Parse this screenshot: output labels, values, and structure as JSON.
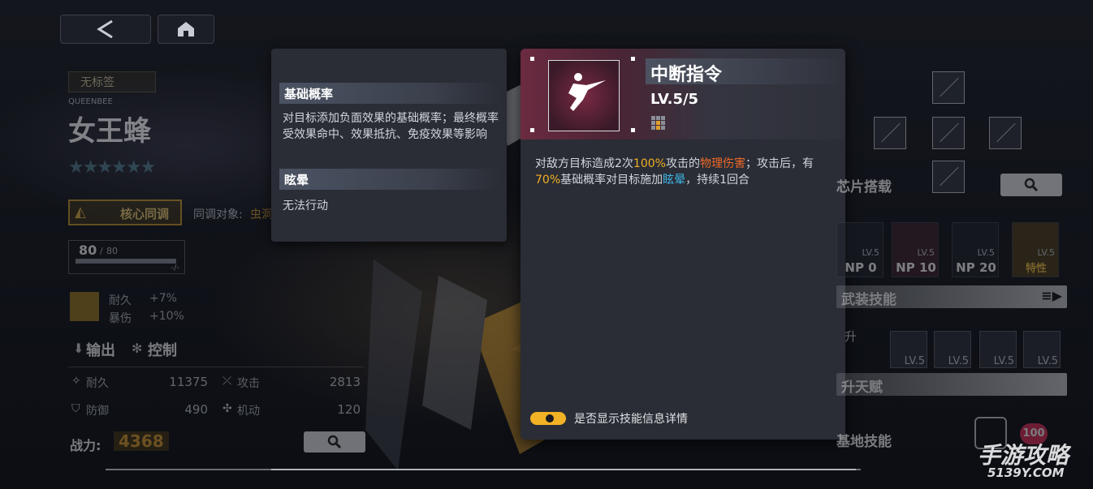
{
  "nav": {
    "back_icon": "back-chevron-icon",
    "home_icon": "home-icon"
  },
  "character": {
    "tag": "无标签",
    "code_name": "QUEENBEE",
    "name": "女王蜂",
    "stars": "★★★★★★",
    "sync_label": "核心同调",
    "sync_target_label": "同调对象:",
    "sync_target_value": "虫洞",
    "level_current": "80",
    "level_max": "80",
    "exp_text": "-/-",
    "bonus1_label": "耐久",
    "bonus1_value": "+7%",
    "bonus2_label": "暴伤",
    "bonus2_value": "+10%",
    "role1": "输出",
    "role2": "控制",
    "stats": [
      {
        "label": "耐久",
        "value": "11375"
      },
      {
        "label": "攻击",
        "value": "2813"
      },
      {
        "label": "防御",
        "value": "490"
      },
      {
        "label": "机动",
        "value": "120"
      }
    ],
    "power_label": "战力:",
    "power_value": "4368"
  },
  "tooltip": {
    "section1_title": "基础概率",
    "section1_text": "对目标添加负面效果的基础概率；最终概率受效果命中、效果抵抗、免疫效果等影响",
    "section2_title": "眩晕",
    "section2_text": "无法行动"
  },
  "skill": {
    "name": "中断指令",
    "level": "LV.5/5",
    "desc": {
      "p1": "对敌方目标造成2次",
      "v1": "100%",
      "p2": "攻击的",
      "v2": "物理伤害",
      "p3": "；攻击后，有",
      "v3": "70%",
      "p4": "基础概率对目标施加",
      "v4": "眩晕",
      "p5": "，持续1回合"
    },
    "toggle_label": "是否显示技能信息详情",
    "toggle_on": true
  },
  "right": {
    "chip_title": "芯片搭载",
    "equip_title": "武装技能",
    "skills": [
      {
        "np": "NP 0",
        "lv": "LV.5"
      },
      {
        "np": "NP 10",
        "lv": "LV.5"
      },
      {
        "np": "NP 20",
        "lv": "LV.5"
      },
      {
        "np": "特性",
        "lv": "LV.5"
      }
    ],
    "ascend_label": "升",
    "ascend_title": "升天赋",
    "talent_levels": [
      "LV.5",
      "LV.5",
      "LV.5",
      "LV.5"
    ],
    "base_title": "基地技能",
    "base_badge": "100"
  },
  "watermark": {
    "text": "手游攻略",
    "site": "5139Y.COM"
  },
  "colors": {
    "accent_yellow": "#f2b025",
    "accent_orange": "#ee6a2a",
    "accent_blue": "#3fb4e6",
    "panel": "#2a2d35",
    "skill_header": "#6b2a40"
  }
}
